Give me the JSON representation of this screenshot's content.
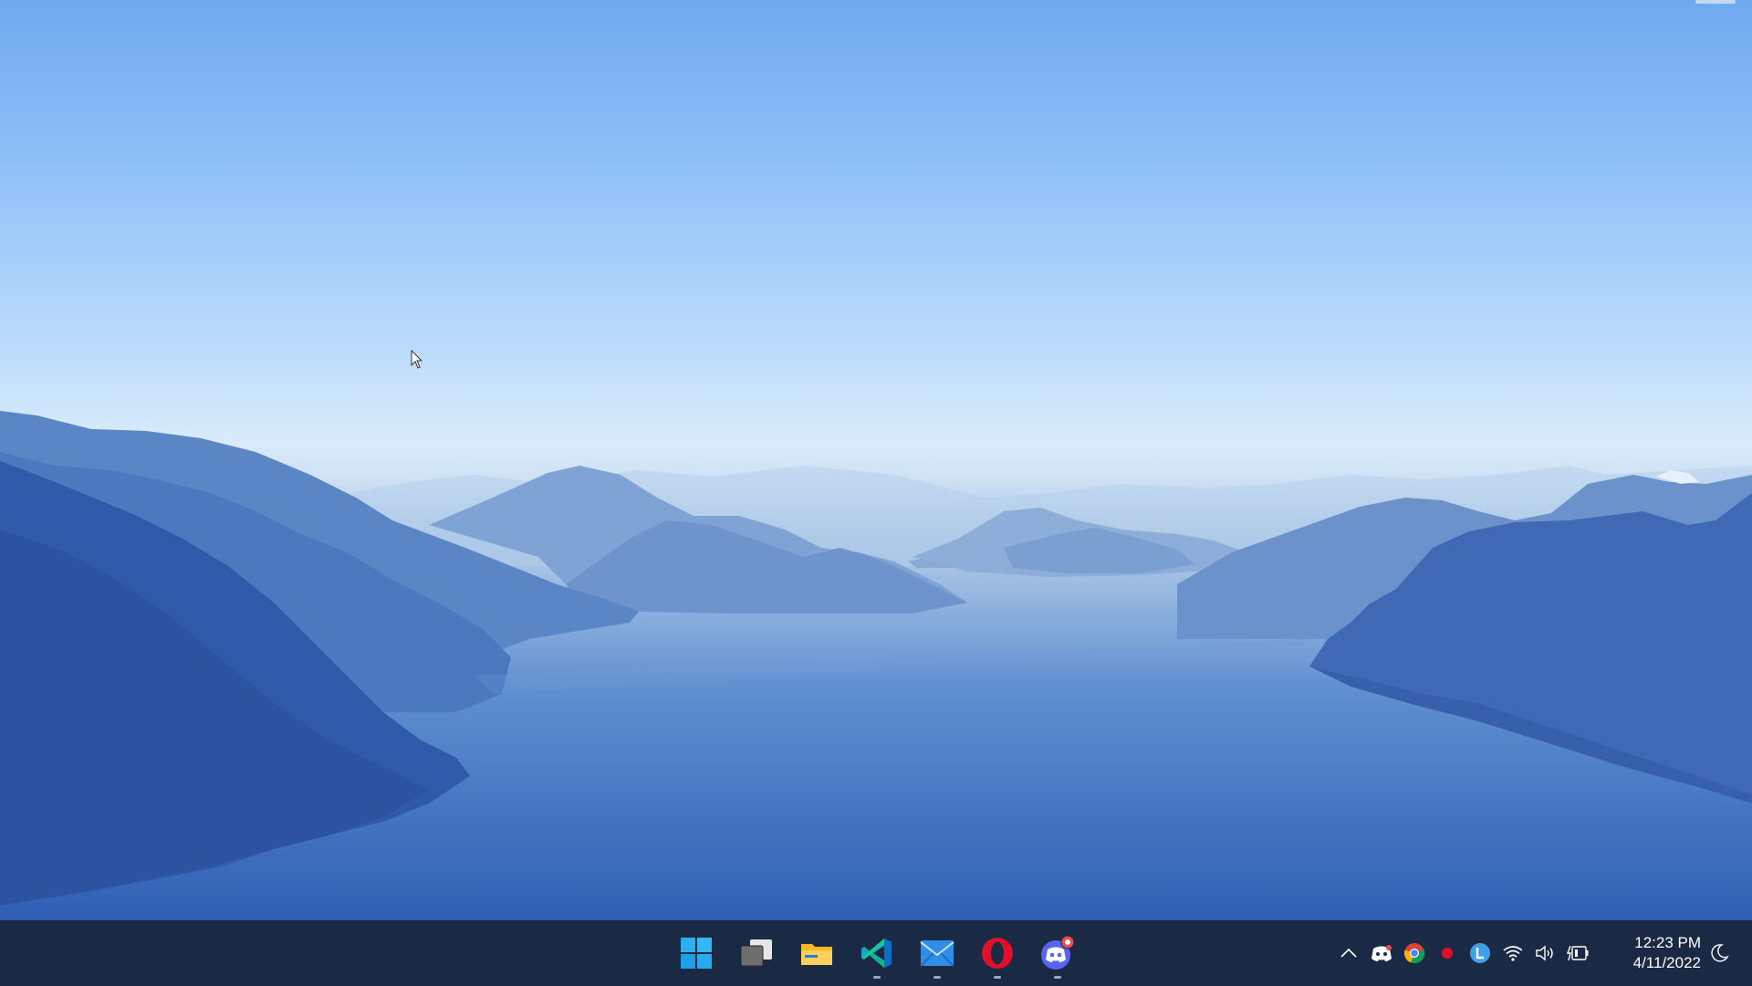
{
  "desktop": {
    "wallpaper": "blue-fjord-landscape",
    "cursor_icon": "arrow-pointer-icon"
  },
  "taskbar": {
    "background": "#1b2a44",
    "pinned_apps": [
      {
        "name": "Start",
        "icon": "windows-logo-icon",
        "running": false
      },
      {
        "name": "Task View",
        "icon": "task-view-icon",
        "running": false
      },
      {
        "name": "File Explorer",
        "icon": "folder-icon",
        "running": false
      },
      {
        "name": "Visual Studio Code",
        "icon": "vscode-icon",
        "running": true
      },
      {
        "name": "Mail",
        "icon": "mail-icon",
        "running": true
      },
      {
        "name": "Opera",
        "icon": "opera-icon",
        "running": true
      },
      {
        "name": "Discord",
        "icon": "discord-icon",
        "running": true,
        "notification": true
      }
    ],
    "tray": {
      "icons": [
        "chevron-up-icon",
        "discord-tray-icon",
        "chrome-icon",
        "record-icon",
        "l-circle-icon",
        "wifi-icon",
        "volume-icon",
        "battery-charging-icon"
      ],
      "clock": {
        "time": "12:23 PM",
        "date": "4/11/2022"
      },
      "focus_icon": "moon-icon"
    }
  }
}
